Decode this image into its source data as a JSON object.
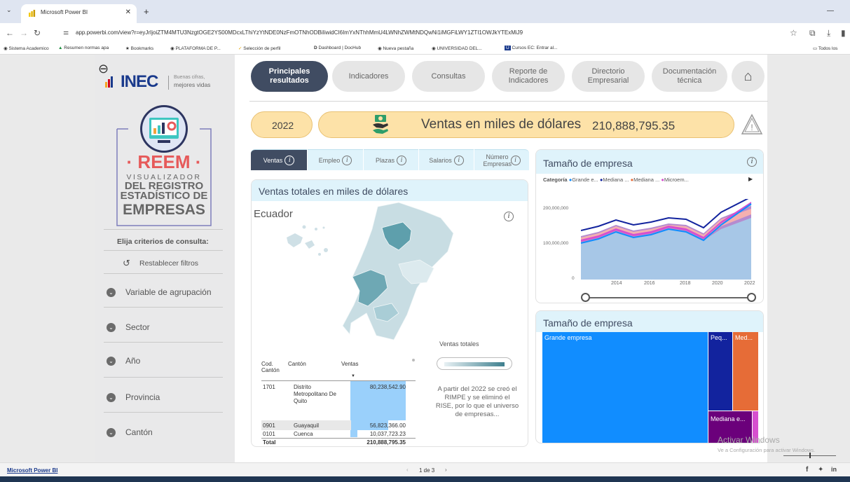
{
  "browser": {
    "tab_title": "Microsoft Power BI",
    "url": "app.powerbi.com/view?r=eyJrIjoiZTM4MTU3NzgtOGE2YS00MDcxLThiYzYtNDE0NzFmOTNhODBiIiwidCI6ImYxNThhMmU4LWNhZWMtNDQwNi1iMGFiLWY1ZTI1OWJkYTExMiJ9",
    "bookmarks": [
      "Sistema Academico",
      "Resumen normas apa",
      "Bookmarks",
      "PLATAFORMA DE P...",
      "Selección de perfil",
      "Dashboard | DocHub",
      "Nueva pestaña",
      "UNIVERSIDAD DEL...",
      "Cursos EC: Entrar al..."
    ],
    "all_bookmarks": "Todos los"
  },
  "brand": {
    "logo_text": "INEC",
    "tagline_1": "Buenas cifras,",
    "tagline_2": "mejores vidas"
  },
  "reem": {
    "title": "· REEM ·",
    "line1": "VISUALIZADOR",
    "line2": "DEL REGISTRO",
    "line3": "ESTADÍSTICO DE",
    "line4": "EMPRESAS"
  },
  "sidebar": {
    "criteria_label": "Elija criterios de consulta:",
    "reset_label": "Restablecer filtros",
    "filters": [
      "Variable de agrupación",
      "Sector",
      "Año",
      "Provincia",
      "Cantón"
    ]
  },
  "nav": {
    "buttons": [
      "Principales resultados",
      "Indicadores",
      "Consultas",
      "Reporte de Indicadores",
      "Directorio Empresarial",
      "Documentación técnica"
    ]
  },
  "kpi": {
    "year": "2022",
    "label": "Ventas en miles de dólares",
    "value": "210,888,795.35"
  },
  "subtabs": [
    "Ventas",
    "Empleo",
    "Plazas",
    "Salarios",
    "Número Empresas"
  ],
  "map_card": {
    "title": "Ventas totales en miles de dólares",
    "region": "Ecuador",
    "legend_title": "Ventas totales",
    "note": "A partir del 2022 se creó el RIMPE y se eliminó el RISE, por lo que el universo de empresas...",
    "table": {
      "headers": [
        "Cod. Cantón",
        "Cantón",
        "Ventas"
      ],
      "rows": [
        {
          "code": "1701",
          "name": "Distrito Metropolitano De Quito",
          "value": "80,238,542.90"
        },
        {
          "code": "0901",
          "name": "Guayaquil",
          "value": "56,823,366.00"
        },
        {
          "code": "0101",
          "name": "Cuenca",
          "value": "10,037,723.23"
        }
      ],
      "total_label": "Total",
      "total_value": "210,888,795.35"
    }
  },
  "area_card": {
    "title": "Tamaño de empresa",
    "legend_label": "Categoría",
    "legend_items": [
      "Grande e...",
      "Mediana ...",
      "Mediana ...",
      "Microem..."
    ],
    "y_ticks": [
      "200,000,000",
      "100,000,000",
      "0"
    ],
    "x_ticks": [
      "2014",
      "2016",
      "2018",
      "2020",
      "2022"
    ]
  },
  "treemap_card": {
    "title": "Tamaño de empresa",
    "labels": [
      "Grande empresa",
      "Peq...",
      "Med...",
      "Mediana e..."
    ]
  },
  "colors": {
    "grande": "#118dff",
    "mediana_b": "#12239e",
    "mediana_a": "#e66c37",
    "micro": "#d64fcf",
    "nav_active": "#404c62",
    "accent_light": "#dff3fb"
  },
  "footer": {
    "app_name": "Microsoft Power BI",
    "page_indicator": "1 de 3",
    "watermark_1": "Activar Windows",
    "watermark_2": "Ve a Configuración para activar Windows."
  }
}
